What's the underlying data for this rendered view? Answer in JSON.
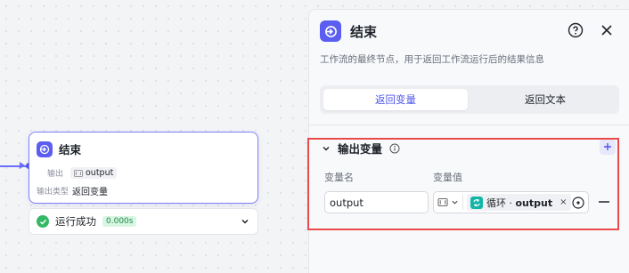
{
  "node": {
    "title": "结束",
    "output_label": "输出",
    "output_var": "output",
    "output_type_label": "输出类型",
    "output_type_value": "返回变量"
  },
  "run": {
    "status_text": "运行成功",
    "duration": "0.000s"
  },
  "panel": {
    "title": "结束",
    "description": "工作流的最终节点，用于返回工作流运行后的结果信息",
    "tabs": [
      {
        "label": "返回变量",
        "active": true
      },
      {
        "label": "返回文本",
        "active": false
      }
    ],
    "section_title": "输出变量",
    "col_name_label": "变量名",
    "col_value_label": "变量值",
    "row": {
      "name_value": "output",
      "ref_source": "循环 · ",
      "ref_var": "output"
    }
  },
  "colors": {
    "accent": "#4d53e8",
    "node_icon": "#5b5ef0",
    "success": "#34b866",
    "loop_icon": "#13b6a6",
    "highlight": "#ec4a4a"
  }
}
